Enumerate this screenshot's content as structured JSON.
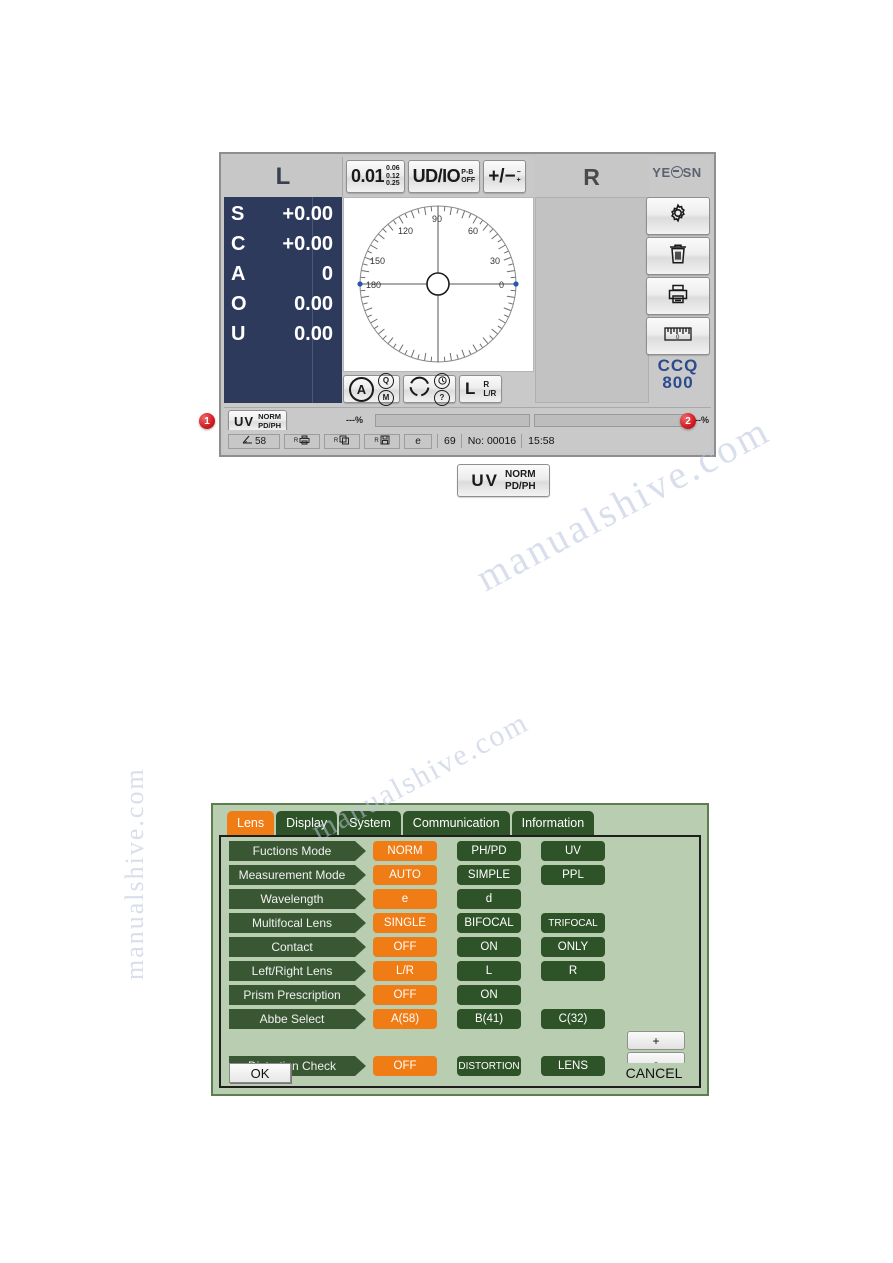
{
  "watermark": [
    "manualshive.com",
    "manualshive.com",
    "manualshive.com"
  ],
  "device": {
    "header": {
      "left_eye": "L",
      "right_eye": "R",
      "brand": "YE",
      "brand_tail": "SN"
    },
    "top_buttons": [
      {
        "name": "step-button",
        "main": "0.01",
        "stack": [
          "0.06",
          "0.12",
          "0.25"
        ]
      },
      {
        "name": "udio-button",
        "main": "UD/IO",
        "sup": "P-B",
        "sub": "OFF"
      },
      {
        "name": "plus-minus-button",
        "main": "+/−",
        "sup": "−",
        "sub": "+"
      }
    ],
    "measurements": [
      {
        "key": "S",
        "value": "+0.00"
      },
      {
        "key": "C",
        "value": "+0.00"
      },
      {
        "key": "A",
        "value": "0"
      },
      {
        "key": "O",
        "value": "0.00"
      },
      {
        "key": "U",
        "value": "0.00"
      }
    ],
    "protractor": {
      "ticks": [
        "30",
        "60",
        "90",
        "120",
        "150",
        "180",
        "0"
      ],
      "labels": {
        "t0": "0",
        "t30": "30",
        "t60": "60",
        "t90": "90",
        "t120": "120",
        "t150": "150",
        "t180": "180"
      }
    },
    "tool_row": {
      "auto_mode": "A",
      "qm_top": "Q",
      "qm_bottom": "M",
      "clock_top": "⏱",
      "clock_bottom": "?",
      "lr_main": "L",
      "lr_sup": "R",
      "lr_sub": "L/R"
    },
    "rail_icons": [
      "gear-icon",
      "trash-icon",
      "printer-icon",
      "ruler-icon"
    ],
    "model": {
      "line1": "CCQ",
      "line2": "800"
    },
    "strip": {
      "uv_label": "UV",
      "norm_label": "NORM",
      "pdph_label": "PD/PH",
      "percent_left": "---%",
      "percent_right": "---%"
    },
    "status_bar": {
      "angle_icon": "angle-icon",
      "angle_value": "58",
      "printer_cell": "R",
      "copy_cell": "R",
      "save_cell": "R",
      "euro_cell": "e",
      "counter": "69",
      "record_label": "No: 00016",
      "time": "15:58"
    },
    "markers": {
      "one": "1",
      "two": "2"
    }
  },
  "uv_callout": {
    "uv": "UV",
    "norm": "NORM",
    "pdph": "PD/PH"
  },
  "settings": {
    "tabs": [
      {
        "label": "Lens",
        "active": true
      },
      {
        "label": "Display",
        "active": false
      },
      {
        "label": "System",
        "active": false
      },
      {
        "label": "Communication",
        "active": false
      },
      {
        "label": "Information",
        "active": false
      }
    ],
    "rows": [
      {
        "label": "Fuctions Mode",
        "options": [
          "NORM",
          "PH/PD",
          "UV"
        ],
        "selected": 0
      },
      {
        "label": "Measurement Mode",
        "options": [
          "AUTO",
          "SIMPLE",
          "PPL"
        ],
        "selected": 0
      },
      {
        "label": "Wavelength",
        "options": [
          "e",
          "d"
        ],
        "selected": 0
      },
      {
        "label": "Multifocal Lens",
        "options": [
          "SINGLE",
          "BIFOCAL",
          "TRIFOCAL"
        ],
        "selected": 0
      },
      {
        "label": "Contact",
        "options": [
          "OFF",
          "ON",
          "ONLY"
        ],
        "selected": 0
      },
      {
        "label": "Left/Right Lens",
        "options": [
          "L/R",
          "L",
          "R"
        ],
        "selected": 0
      },
      {
        "label": "Prism Prescription",
        "options": [
          "OFF",
          "ON"
        ],
        "selected": 0
      },
      {
        "label": "Abbe Select",
        "options": [
          "A(58)",
          "B(41)",
          "C(32)"
        ],
        "selected": 0
      },
      {
        "label": "Distortion Check",
        "options": [
          "OFF",
          "DISTORTION",
          "LENS"
        ],
        "selected": 0
      }
    ],
    "plus_label": "+",
    "minus_label": "-",
    "ok_label": "OK",
    "cancel_label": "CANCEL"
  },
  "colors": {
    "accent_orange": "#f07c16",
    "panel_green": "#b9cdb0",
    "option_green": "#2f5328",
    "data_navy": "#2e3a5c",
    "brand_blue": "#2c4a8c"
  }
}
